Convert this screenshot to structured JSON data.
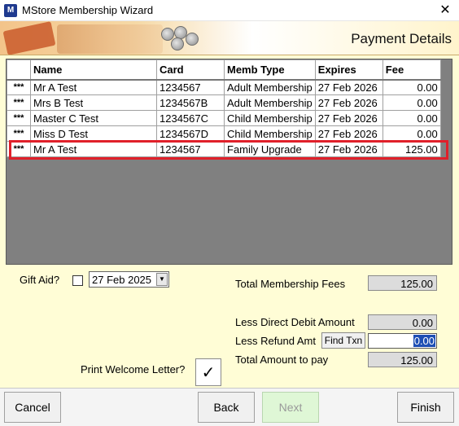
{
  "window": {
    "title": "MStore Membership Wizard",
    "close_glyph": "✕",
    "icon_letters": "M"
  },
  "banner": {
    "title": "Payment Details"
  },
  "grid": {
    "columns": [
      "",
      "Name",
      "Card",
      "Memb Type",
      "Expires",
      "Fee"
    ],
    "rows": [
      {
        "marker": "***",
        "name": "Mr A Test",
        "card": "1234567",
        "type": "Adult Membership",
        "expires": "27 Feb 2026",
        "fee": "0.00"
      },
      {
        "marker": "***",
        "name": "Mrs B Test",
        "card": "1234567B",
        "type": "Adult Membership",
        "expires": "27 Feb 2026",
        "fee": "0.00"
      },
      {
        "marker": "***",
        "name": "Master C Test",
        "card": "1234567C",
        "type": "Child Membership",
        "expires": "27 Feb 2026",
        "fee": "0.00"
      },
      {
        "marker": "***",
        "name": "Miss D Test",
        "card": "1234567D",
        "type": "Child Membership",
        "expires": "27 Feb 2026",
        "fee": "0.00"
      },
      {
        "marker": "***",
        "name": "Mr A Test",
        "card": "1234567",
        "type": "Family Upgrade",
        "expires": "27 Feb 2026",
        "fee": "125.00"
      }
    ]
  },
  "gift_aid": {
    "label": "Gift Aid?",
    "checked": false,
    "date": "27 Feb 2025",
    "arrow": "▼"
  },
  "totals": {
    "membership_fees_label": "Total Membership Fees",
    "membership_fees_value": "125.00",
    "direct_debit_label": "Less Direct Debit Amount",
    "direct_debit_value": "0.00",
    "refund_label": "Less Refund Amt",
    "find_txn_label": "Find Txn",
    "refund_value": "0.00",
    "total_label": "Total Amount to pay",
    "total_value": "125.00"
  },
  "welcome": {
    "label": "Print Welcome Letter?",
    "checked_glyph": "✓"
  },
  "buttons": {
    "cancel": "Cancel",
    "back": "Back",
    "next": "Next",
    "finish": "Finish"
  },
  "colors": {
    "background": "#fffdd6",
    "highlight": "#e0202a",
    "grid_bg": "#808080"
  }
}
